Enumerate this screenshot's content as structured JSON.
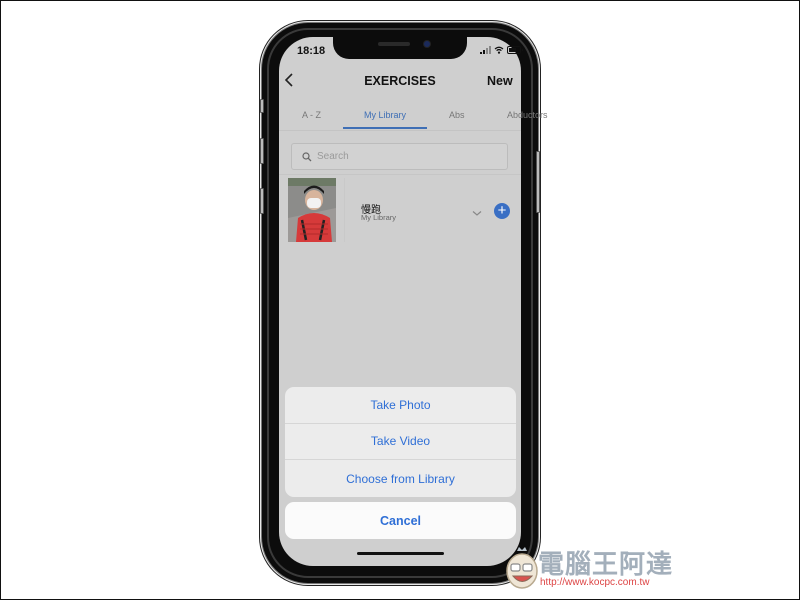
{
  "status_bar": {
    "time": "18:18"
  },
  "nav": {
    "back_icon": "chevron-left-icon",
    "title": "EXERCISES",
    "new_label": "New"
  },
  "tabs": [
    {
      "label": "A - Z",
      "active": false
    },
    {
      "label": "My Library",
      "active": true
    },
    {
      "label": "Abs",
      "active": false
    },
    {
      "label": "Abductors",
      "active": false
    }
  ],
  "search": {
    "placeholder": "Search",
    "value": ""
  },
  "exercises": [
    {
      "title": "慢跑",
      "subtitle": "My Library",
      "thumbnail": "person-selfie-photo"
    }
  ],
  "action_sheet": {
    "options": [
      "Take Photo",
      "Take Video",
      "Choose from Library"
    ],
    "cancel_label": "Cancel"
  },
  "colors": {
    "accent": "#3f6fb5",
    "action_blue": "#2f6fd6",
    "screen_bg": "#cfcfcf"
  },
  "watermark": {
    "text": "電腦王阿達",
    "url": "http://www.kocpc.com.tw"
  }
}
